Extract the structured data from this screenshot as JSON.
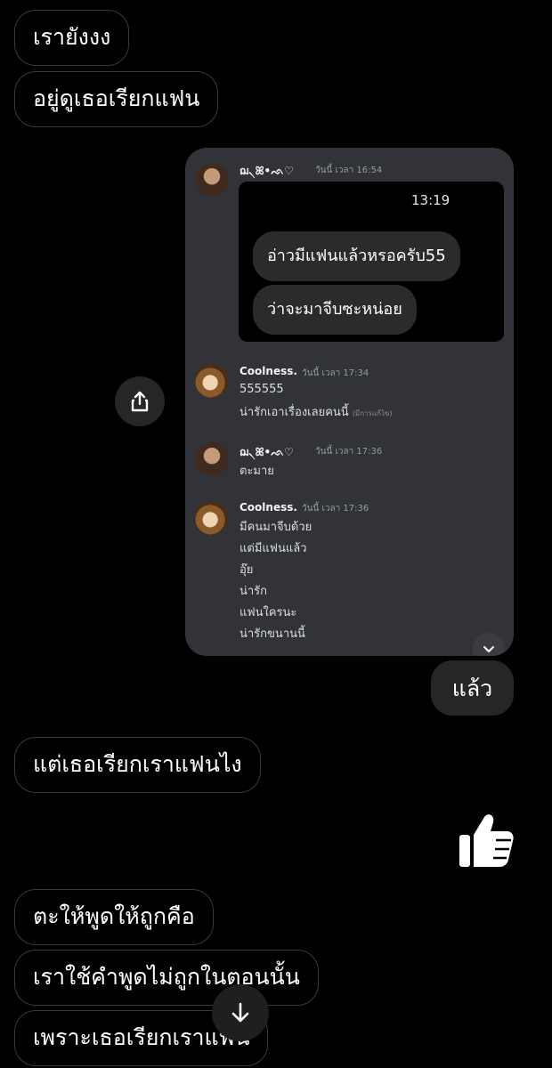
{
  "chat": {
    "in_top": [
      "เรายังงง",
      "อยู่ดูเธอเรียกแฟน"
    ],
    "reply_out": "แล้ว",
    "in_mid": "แต่เธอเรียกเราแฟนไง",
    "reaction": "👍",
    "in_bottom": [
      "ตะให้พูดให้ถูกคือ",
      "เราใช้คำพูดไม่ถูกในตอนนั้น",
      "เพราะเธอเรียกเราแฟน"
    ]
  },
  "screenshot": {
    "m1": {
      "name": "ฌ৲ꕤ•ᨒ♡",
      "time": "วันนี้ เวลา 16:54"
    },
    "inner": {
      "time": "13:19",
      "bubbles": [
        "อ่าวมีแฟนแล้วหรอครับ55",
        "ว่าจะมาจีบซะหน่อย"
      ]
    },
    "m2": {
      "name": "Coolness.",
      "time": "วันนี้ เวลา 17:34",
      "line1": "555555",
      "line2": "น่ารักเอาเรื่องเลยคนนี้",
      "edited": "(มีการแก้ไข)"
    },
    "m3": {
      "name": "ฌ৲ꕤ•ᨒ♡",
      "time": "วันนี้ เวลา 17:36",
      "line1": "ตะมาย"
    },
    "m4": {
      "name": "Coolness.",
      "time": "วันนี้ เวลา 17:36",
      "lines": [
        "มีคนมาจีบด้วย",
        "แต่มีแฟนแล้ว",
        "อุ๊ย",
        "น่ารัก",
        "แฟนใครนะ",
        "น่ารักขนานนี้"
      ]
    }
  },
  "icons": {
    "share": "share-icon",
    "down": "chevron-down-icon",
    "scroll": "arrow-down-icon",
    "like": "thumbs-up-icon"
  }
}
